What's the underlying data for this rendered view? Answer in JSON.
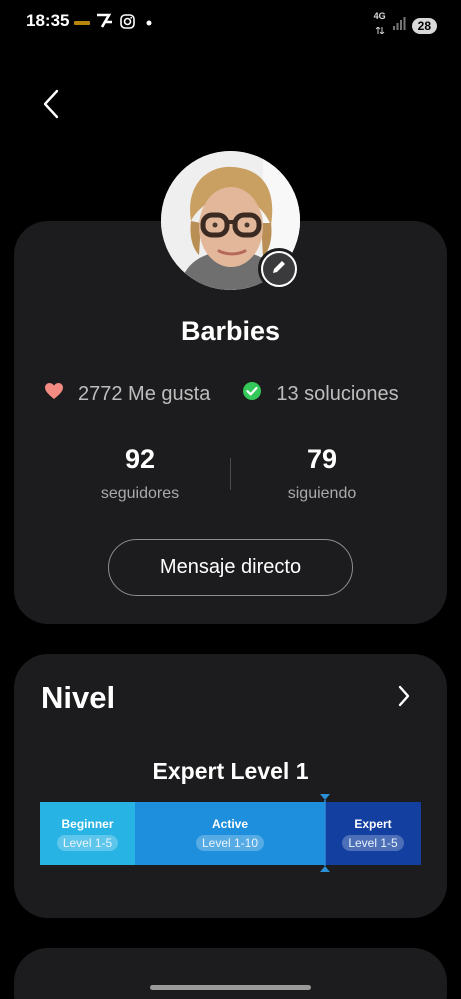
{
  "status_bar": {
    "time": "18:35",
    "network": "4G",
    "battery": "28"
  },
  "profile": {
    "name": "Barbies",
    "likes": "2772 Me gusta",
    "solutions": "13 soluciones",
    "followers_count": "92",
    "followers_label": "seguidores",
    "following_count": "79",
    "following_label": "siguiendo",
    "dm_button_label": "Mensaje directo"
  },
  "level": {
    "section_title": "Nivel",
    "current_level": "Expert Level 1",
    "segments": [
      {
        "name": "Beginner",
        "range": "Level 1-5",
        "color": "#27b3e3"
      },
      {
        "name": "Active",
        "range": "Level 1-10",
        "color": "#1e8fdc"
      },
      {
        "name": "Expert",
        "range": "Level 1-5",
        "color": "#123fa0"
      }
    ]
  },
  "colors": {
    "background": "#000000",
    "card": "#1c1c1e",
    "heart": "#f28b82",
    "check": "#34c759",
    "marker": "#2b8fd6"
  },
  "icons": {
    "back": "chevron-left-icon",
    "edit": "pencil-icon",
    "like": "heart-icon",
    "solution": "check-circle-icon",
    "level_nav": "chevron-right-icon"
  }
}
